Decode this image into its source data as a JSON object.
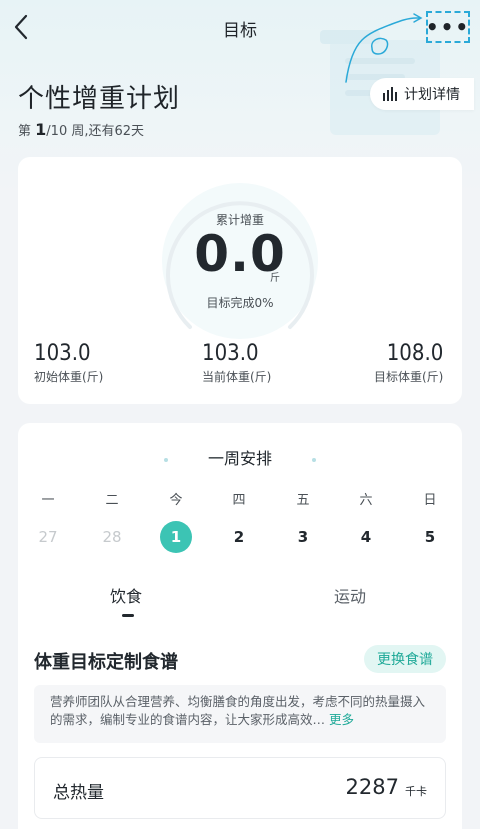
{
  "nav": {
    "title": "目标",
    "more_label": "•••"
  },
  "plan": {
    "title": "个性增重计划",
    "week_prefix": "第",
    "week_current": "1",
    "week_rest": "/10 周,还有62天",
    "detail_label": "计划详情"
  },
  "progress": {
    "gain_label": "累计增重",
    "gain_value": "0.0",
    "gain_unit": "斤",
    "completion_text": "目标完成0%",
    "completion_fraction": 0.0
  },
  "weights": [
    {
      "value": "103.0",
      "label": "初始体重(斤)"
    },
    {
      "value": "103.0",
      "label": "当前体重(斤)"
    },
    {
      "value": "108.0",
      "label": "目标体重(斤)"
    }
  ],
  "week": {
    "title": "一周安排",
    "weekdays": [
      "一",
      "二",
      "今",
      "四",
      "五",
      "六",
      "日"
    ],
    "dates": [
      "27",
      "28",
      "1",
      "2",
      "3",
      "4",
      "5"
    ],
    "today_index": 2,
    "past_count": 2
  },
  "tabs": {
    "food": "饮食",
    "sport": "运动"
  },
  "recipe": {
    "title": "体重目标定制食谱",
    "change_label": "更换食谱",
    "description": "营养师团队从合理营养、均衡膳食的角度出发，考虑不同的热量摄入的需求，编制专业的食谱内容，让大家形成高效…",
    "more_label": "更多",
    "total_label": "总热量",
    "total_value": "2287",
    "total_unit": "千卡"
  },
  "colors": {
    "accent": "#3cc4b4",
    "accent_text": "#1fa998",
    "annotation": "#2aa9d8"
  }
}
